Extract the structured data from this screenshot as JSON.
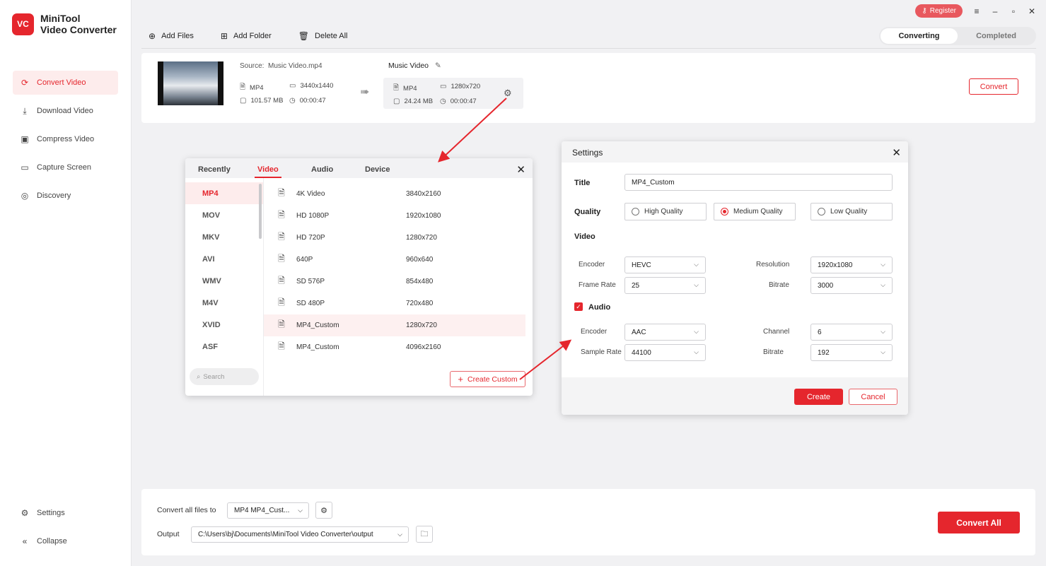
{
  "app": {
    "logo_mark": "VC",
    "name_line1": "MiniTool",
    "name_line2": "Video Converter"
  },
  "sidebar": {
    "items": [
      {
        "label": "Convert Video",
        "active": true
      },
      {
        "label": "Download Video"
      },
      {
        "label": "Compress Video"
      },
      {
        "label": "Capture Screen"
      },
      {
        "label": "Discovery"
      }
    ],
    "settings_label": "Settings",
    "collapse_label": "Collapse"
  },
  "topbar": {
    "register_label": "Register",
    "add_files": "Add Files",
    "add_folder": "Add Folder",
    "delete_all": "Delete All",
    "tab_converting": "Converting",
    "tab_completed": "Completed"
  },
  "file": {
    "source_label": "Source:",
    "source_name": "Music Video.mp4",
    "src_format": "MP4",
    "src_resolution": "3440x1440",
    "src_size": "101.57 MB",
    "src_duration": "00:00:47",
    "target_name": "Music Video",
    "tgt_format": "MP4",
    "tgt_resolution": "1280x720",
    "tgt_size": "24.24 MB",
    "tgt_duration": "00:00:47",
    "convert_label": "Convert"
  },
  "format_popup": {
    "tabs": [
      "Recently",
      "Video",
      "Audio",
      "Device"
    ],
    "active_tab": "Video",
    "formats": [
      "MP4",
      "MOV",
      "MKV",
      "AVI",
      "WMV",
      "M4V",
      "XVID",
      "ASF"
    ],
    "search_placeholder": "Search",
    "presets": [
      {
        "name": "4K Video",
        "res": "3840x2160"
      },
      {
        "name": "HD 1080P",
        "res": "1920x1080"
      },
      {
        "name": "HD 720P",
        "res": "1280x720"
      },
      {
        "name": "640P",
        "res": "960x640"
      },
      {
        "name": "SD 576P",
        "res": "854x480"
      },
      {
        "name": "SD 480P",
        "res": "720x480"
      },
      {
        "name": "MP4_Custom",
        "res": "1280x720"
      },
      {
        "name": "MP4_Custom",
        "res": "4096x2160"
      }
    ],
    "create_custom": "Create Custom"
  },
  "settings": {
    "title": "Settings",
    "title_label": "Title",
    "title_value": "MP4_Custom",
    "quality_label": "Quality",
    "quality_options": [
      "High Quality",
      "Medium Quality",
      "Low Quality"
    ],
    "quality_selected": "Medium Quality",
    "video_label": "Video",
    "video_encoder_label": "Encoder",
    "video_encoder": "HEVC",
    "resolution_label": "Resolution",
    "resolution": "1920x1080",
    "frame_rate_label": "Frame Rate",
    "frame_rate": "25",
    "video_bitrate_label": "Bitrate",
    "video_bitrate": "3000",
    "audio_label": "Audio",
    "audio_enabled": true,
    "audio_encoder_label": "Encoder",
    "audio_encoder": "AAC",
    "channel_label": "Channel",
    "channel": "6",
    "sample_rate_label": "Sample Rate",
    "sample_rate": "44100",
    "audio_bitrate_label": "Bitrate",
    "audio_bitrate": "192",
    "create_label": "Create",
    "cancel_label": "Cancel"
  },
  "bottom": {
    "convert_all_to_label": "Convert all files to",
    "convert_all_to_value": "MP4 MP4_Cust...",
    "output_label": "Output",
    "output_path": "C:\\Users\\bj\\Documents\\MiniTool Video Converter\\output",
    "convert_all_label": "Convert All"
  },
  "colors": {
    "accent": "#e5262d",
    "accent_light": "#fdecec",
    "register": "#e8585e"
  }
}
